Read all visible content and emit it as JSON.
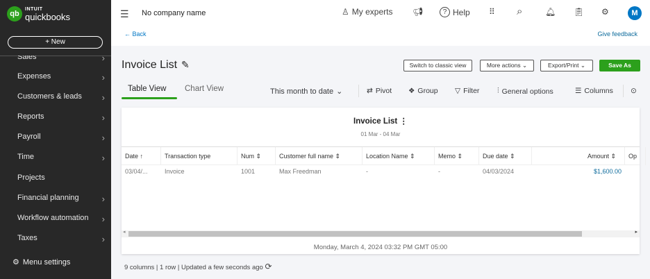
{
  "brand": {
    "line1": "INTUIT",
    "line2": "quickbooks",
    "mark": "qb"
  },
  "sidebar": {
    "new_label": "+   New",
    "items": [
      {
        "label": "Sales",
        "chevron": true
      },
      {
        "label": "Expenses",
        "chevron": true
      },
      {
        "label": "Customers & leads",
        "chevron": true
      },
      {
        "label": "Reports",
        "chevron": true
      },
      {
        "label": "Payroll",
        "chevron": true
      },
      {
        "label": "Time",
        "chevron": true
      },
      {
        "label": "Projects",
        "chevron": false
      },
      {
        "label": "Financial planning",
        "chevron": true
      },
      {
        "label": "Workflow automation",
        "chevron": true
      },
      {
        "label": "Taxes",
        "chevron": true
      }
    ],
    "menu_settings": "Menu settings"
  },
  "topbar": {
    "company": "No company name",
    "my_experts": "My experts",
    "help": "Help",
    "avatar": "M",
    "back": "Back",
    "feedback": "Give feedback"
  },
  "page": {
    "title": "Invoice List",
    "buttons": {
      "classic": "Switch to classic view",
      "more": "More actions",
      "export": "Export/Print",
      "save": "Save As"
    },
    "tabs": [
      "Table View",
      "Chart View"
    ],
    "toolbar": {
      "date_range": "This month to date",
      "pivot": "Pivot",
      "group": "Group",
      "filter": "Filter",
      "general": "General options",
      "columns": "Columns"
    }
  },
  "report": {
    "title": "Invoice List",
    "date_range": "01 Mar - 04 Mar",
    "columns": [
      "Date ↑",
      "Transaction type",
      "Num ⇕",
      "Customer full name ⇕",
      "Location Name ⇕",
      "Memo ⇕",
      "Due date ⇕",
      "Amount ⇕",
      "Op"
    ],
    "rows": [
      [
        "03/04/...",
        "Invoice",
        "1001",
        "Max Freedman",
        "-",
        "-",
        "04/03/2024",
        "$1,600.00",
        ""
      ]
    ],
    "timestamp": "Monday, March 4, 2024 03:32 PM GMT 05:00"
  },
  "status": "9 columns | 1 row | Updated a few seconds ago",
  "colors": {
    "accent": "#2ca01c",
    "link": "#0077c5",
    "sidebar": "#282828"
  }
}
